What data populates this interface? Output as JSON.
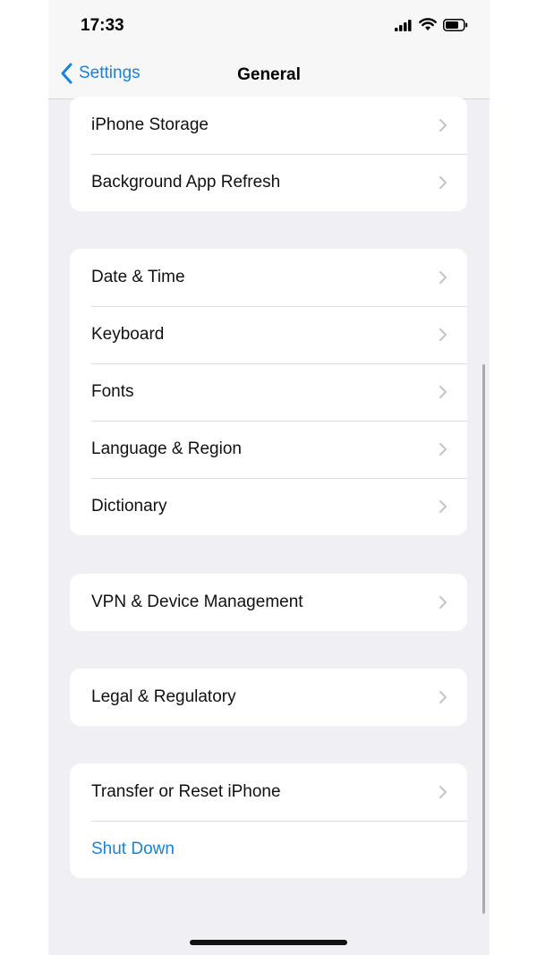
{
  "status_bar": {
    "time": "17:33",
    "icons": [
      "cellular-signal-icon",
      "wifi-icon",
      "battery-icon"
    ]
  },
  "nav": {
    "back_label": "Settings",
    "title": "General"
  },
  "groups": [
    {
      "items": [
        {
          "label": "iPhone Storage"
        },
        {
          "label": "Background App Refresh"
        }
      ]
    },
    {
      "items": [
        {
          "label": "Date & Time"
        },
        {
          "label": "Keyboard"
        },
        {
          "label": "Fonts"
        },
        {
          "label": "Language & Region"
        },
        {
          "label": "Dictionary"
        }
      ]
    },
    {
      "items": [
        {
          "label": "VPN & Device Management"
        }
      ]
    },
    {
      "items": [
        {
          "label": "Legal & Regulatory"
        }
      ]
    },
    {
      "items": [
        {
          "label": "Transfer or Reset iPhone"
        },
        {
          "label": "Shut Down"
        }
      ]
    }
  ],
  "colors": {
    "accent": "#1a82d9",
    "background": "#efeff4",
    "cell": "#ffffff"
  }
}
